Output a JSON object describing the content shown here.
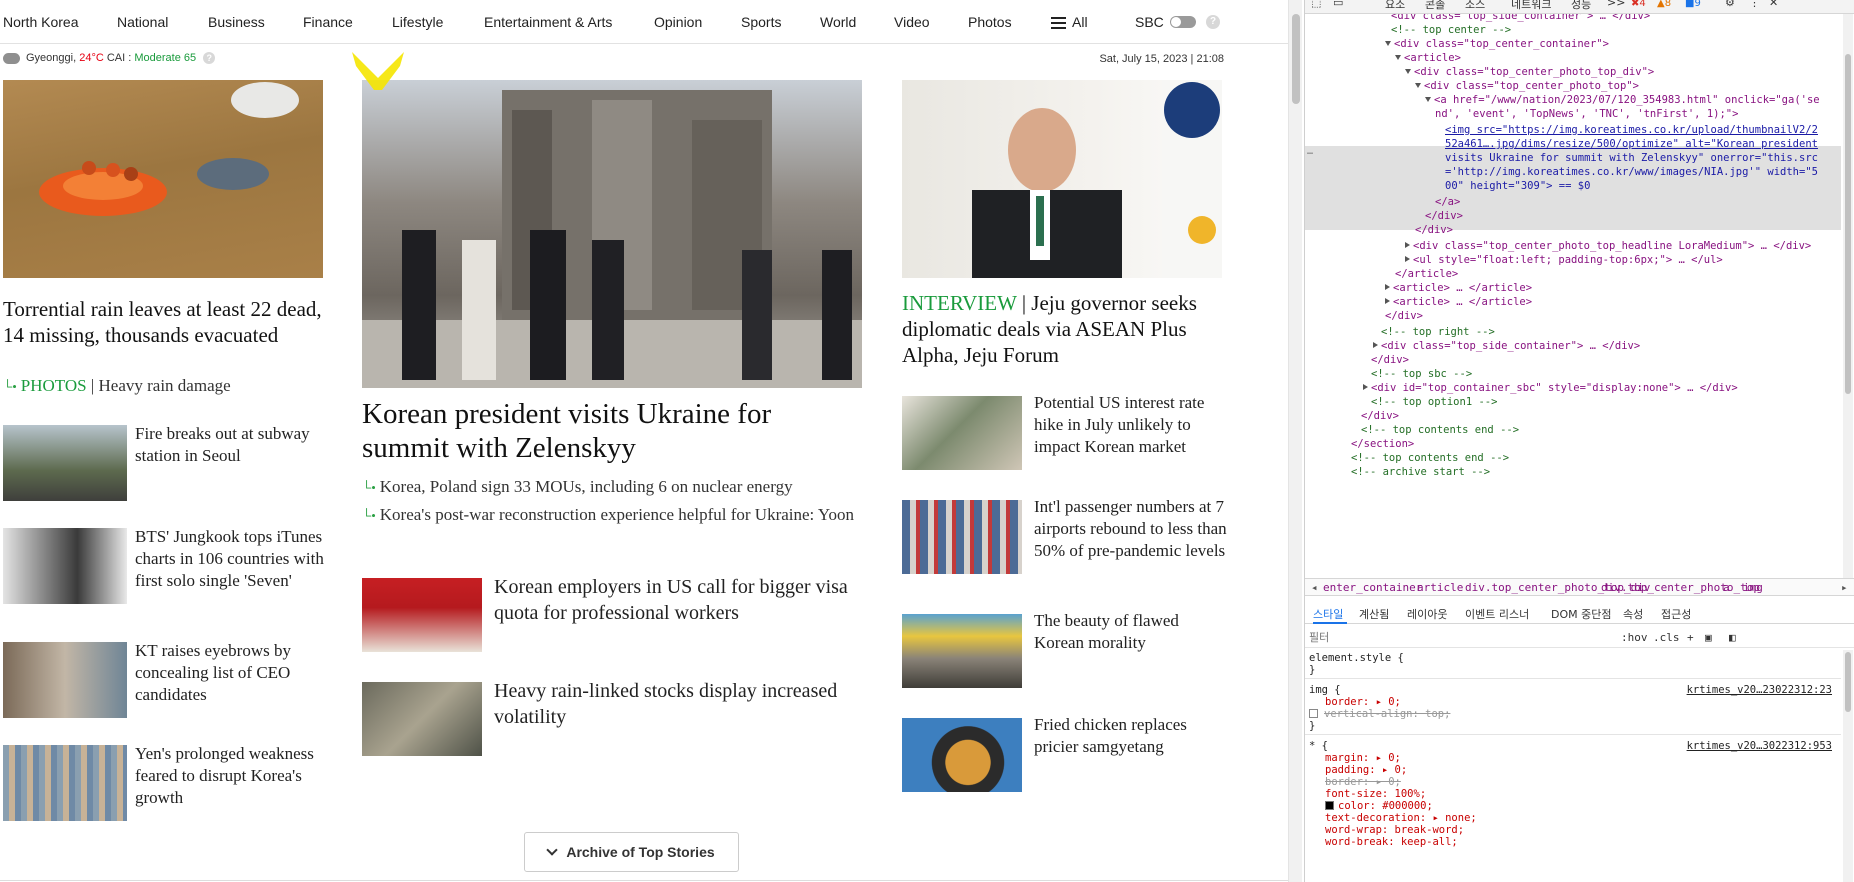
{
  "nav": {
    "items": [
      "North Korea",
      "National",
      "Business",
      "Finance",
      "Lifestyle",
      "Entertainment & Arts",
      "Opinion",
      "Sports",
      "World",
      "Video",
      "Photos"
    ],
    "all_label": "All",
    "sbc_label": "SBC",
    "help": "?"
  },
  "weather": {
    "region": "Gyeonggi,",
    "temp": "24°C",
    "cai_label": "CAI :",
    "cai_value": "Moderate 65",
    "help": "?"
  },
  "date": "Sat, July 15, 2023 | 21:08",
  "left_col": {
    "lead_headline": "Torrential rain leaves at least 22 dead, 14 missing, thousands evacuated",
    "lead_sub_tag": "PHOTOS",
    "lead_sub_text": " | Heavy rain damage",
    "stories": [
      {
        "title": "Fire breaks out at subway station in Seoul"
      },
      {
        "title": "BTS' Jungkook tops iTunes charts in 106 countries with first solo single 'Seven'"
      },
      {
        "title": "KT raises eyebrows by concealing list of CEO candidates"
      },
      {
        "title": "Yen's prolonged weakness feared to disrupt Korea's growth"
      }
    ]
  },
  "center_col": {
    "main_headline": "Korean president visits Ukraine for summit with Zelenskyy",
    "sub_links": [
      "Korea, Poland sign 33 MOUs, including 6 on nuclear energy",
      "Korea's post-war reconstruction experience helpful for Ukraine: Yoon"
    ],
    "stories": [
      {
        "title": "Korean employers in US call for bigger visa quota for professional workers"
      },
      {
        "title": "Heavy rain-linked stocks display increased volatility"
      }
    ],
    "archive_label": "Archive of Top Stories"
  },
  "right_col": {
    "interview_tag": "INTERVIEW",
    "interview_headline": " | Jeju governor seeks diplomatic deals via ASEAN Plus Alpha, Jeju Forum",
    "stories": [
      {
        "title": "Potential US interest rate hike in July unlikely to impact Korean market"
      },
      {
        "title": "Int'l passenger numbers at 7 airports rebound to less than 50% of pre-pandemic levels"
      },
      {
        "title": "The beauty of flawed Korean morality"
      },
      {
        "title": "Fried chicken replaces pricier samgyetang"
      }
    ]
  },
  "devtools": {
    "tabs": [
      "요소",
      "콘솔",
      "소스",
      "네트워크",
      "성능",
      ">>"
    ],
    "errors": "4",
    "warnings": "8",
    "messages": "9",
    "dom_lines": [
      "<div class=\"top_side_container\"> … </div>",
      "<!-- top center -->",
      "<div class=\"top_center_container\">",
      "<article>",
      "<div class=\"top_center_photo_top_div\">",
      "<div class=\"top_center_photo_top\">",
      "<a href=\"/www/nation/2023/07/120_354983.html\" onclick=\"ga('se",
      "nd', 'event', 'TopNews', 'TNC', 'tnFirst', 1);\">",
      "<img src=\"https://img.koreatimes.co.kr/upload/thumbnailV2/2",
      "52a461….jpg/dims/resize/500/optimize\" alt=\"Korean president",
      "visits Ukraine for summit with Zelenskyy\" onerror=\"this.src",
      "='http://img.koreatimes.co.kr/www/images/NIA.jpg'\" width=\"5",
      "00\" height=\"309\"> == $0",
      "</a>",
      "</div>",
      "</div>",
      "<div class=\"top_center_photo_top_headline LoraMedium\"> … </div>",
      "<ul style=\"float:left; padding-top:6px;\"> … </ul>",
      "</article>",
      "<article> … </article>",
      "<article> … </article>",
      "</div>",
      "<!-- top right -->",
      "<div class=\"top_side_container\"> … </div>",
      "</div>",
      "<!-- top sbc -->",
      "<div id=\"top_container_sbc\" style=\"display:none\"> … </div>",
      "<!-- top option1 -->",
      "</div>",
      "<!-- top contents end -->",
      "</section>",
      "<!-- top contents end -->",
      "<!-- archive start -->"
    ],
    "breadcrumb": [
      "◂",
      "enter_container",
      "article",
      "div.top_center_photo_top_div",
      "div.top_center_photo_top",
      "a",
      "img",
      "▸"
    ],
    "style_tabs": [
      "스타일",
      "계산됨",
      "레이아웃",
      "이벤트 리스너",
      "DOM 중단점",
      "속성",
      "접근성"
    ],
    "filter_placeholder": "필터",
    "filter_tools": [
      ":hov",
      ".cls",
      "+"
    ],
    "css": {
      "element_style": "element.style {",
      "close": "}",
      "img_selector": "img {",
      "img_source": "krtimes_v20…23022312:23",
      "img_rules": [
        "border: ▸ 0;",
        "vertical-align: top;"
      ],
      "star_selector": "* {",
      "star_source": "krtimes_v20…3022312:953",
      "star_rules": [
        "margin: ▸ 0;",
        "padding: ▸ 0;",
        "border: ▸ 0;",
        "font-size: 100%;",
        "color: #000000;",
        "text-decoration: ▸ none;",
        "word-wrap: break-word;",
        "word-break: keep-all;"
      ]
    }
  }
}
